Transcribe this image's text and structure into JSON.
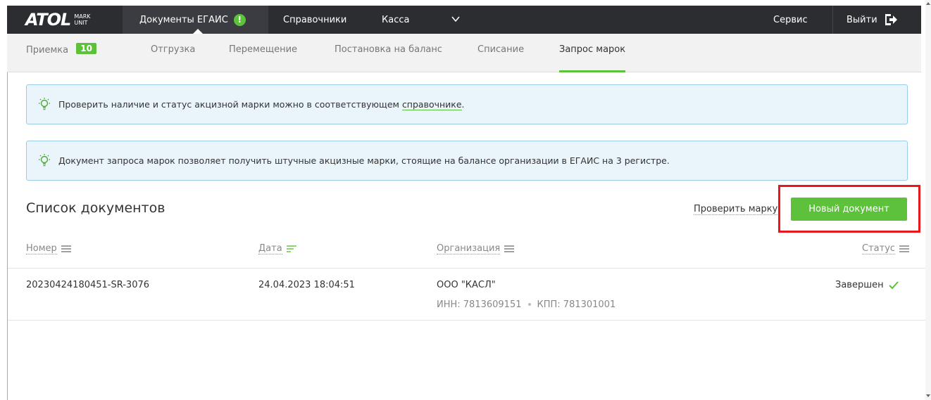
{
  "brand": {
    "main": "ATOL",
    "sub_top": "MARK",
    "sub_bottom": "UNIT"
  },
  "topnav": {
    "documents_label": "Документы ЕГАИС",
    "alert_glyph": "!",
    "references_label": "Справочники",
    "cashier_label": "Касса",
    "service_label": "Сервис",
    "logout_label": "Выйти"
  },
  "subnav": {
    "items": [
      {
        "label": "Приемка",
        "badge": "10"
      },
      {
        "label": "Отгрузка"
      },
      {
        "label": "Перемещение"
      },
      {
        "label": "Постановка на баланс"
      },
      {
        "label": "Списание"
      },
      {
        "label": "Запрос марок"
      }
    ]
  },
  "info": {
    "box1_prefix": "Проверить наличие и статус акцизной марки можно в соответствующем ",
    "box1_link": "справочнике",
    "box1_suffix": ".",
    "box2_text": "Документ запроса марок позволяет получить штучные акцизные марки, стоящие на балансе организации в ЕГАИС на 3 регистре."
  },
  "list": {
    "title": "Список документов",
    "check_mark_label": "Проверить марку",
    "new_doc_label": "Новый документ"
  },
  "table": {
    "headers": {
      "number": "Номер",
      "date": "Дата",
      "org": "Организация",
      "status": "Статус"
    },
    "rows": [
      {
        "number": "20230424180451-SR-3076",
        "date": "24.04.2023 18:04:51",
        "org": "ООО \"КАСЛ\"",
        "inn": "ИНН: 7813609151",
        "kpp": "КПП: 781301001",
        "status": "Завершен"
      }
    ]
  },
  "colors": {
    "accent": "#5dc13b",
    "topbar": "#2b2d31",
    "highlight": "#e8171c",
    "info_bg": "#e9f4fb"
  }
}
